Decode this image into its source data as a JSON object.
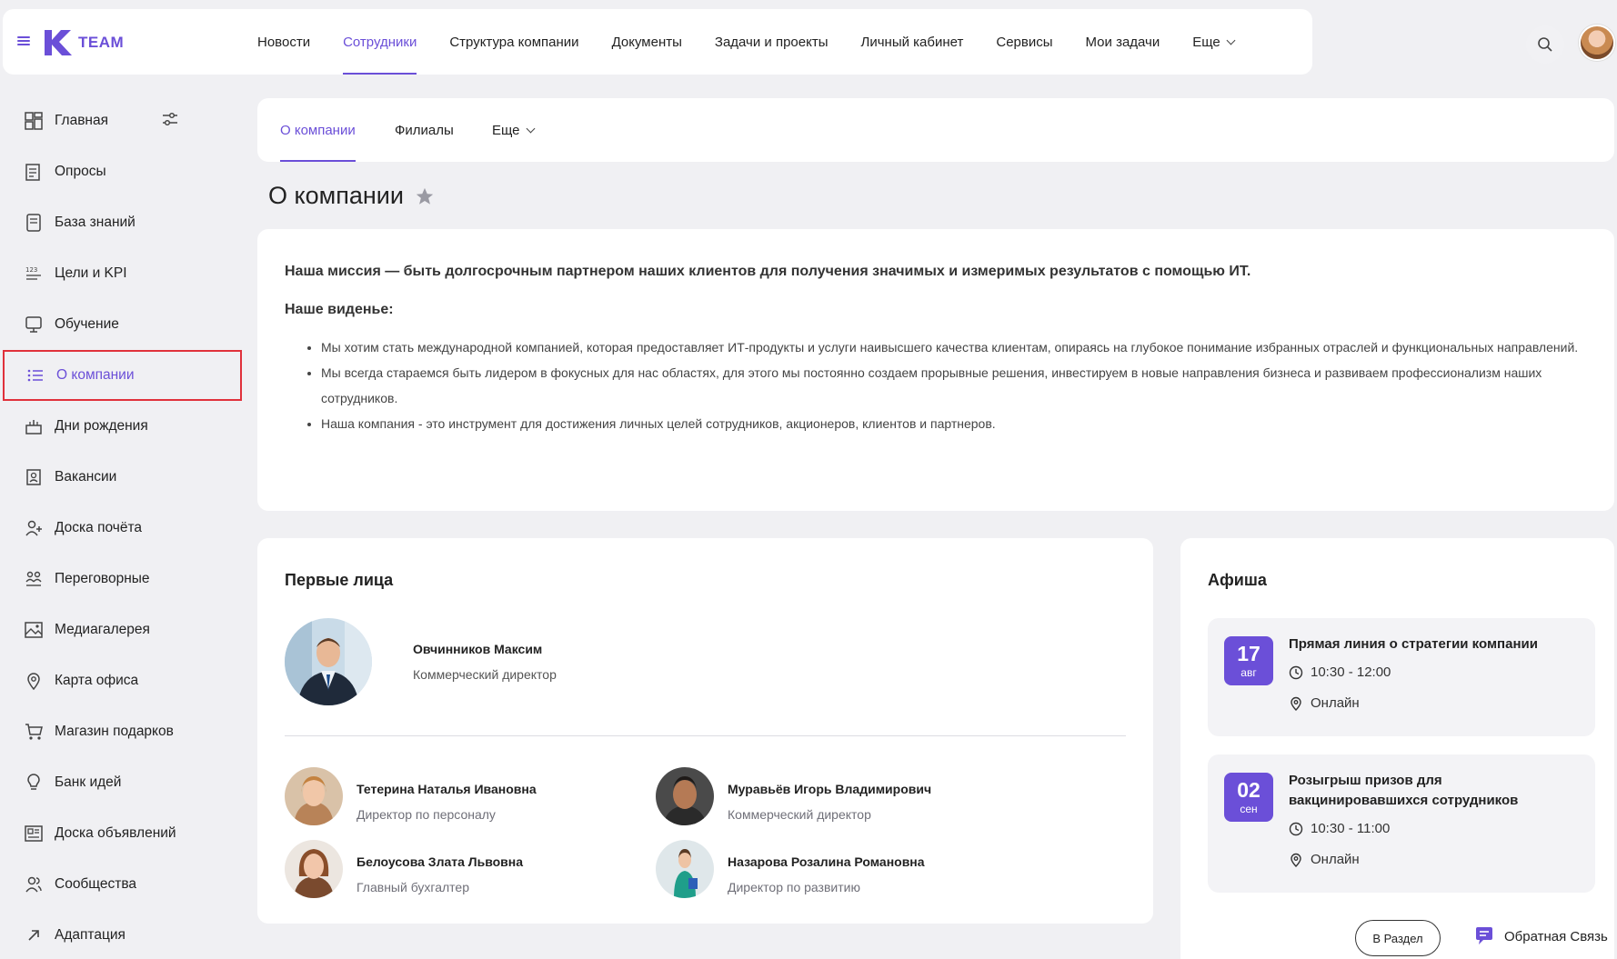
{
  "brand": {
    "name": "TEAM",
    "accent": "#6b4fd8"
  },
  "topnav": {
    "items": [
      "Новости",
      "Сотрудники",
      "Структура компании",
      "Документы",
      "Задачи и проекты",
      "Личный кабинет",
      "Сервисы",
      "Мои задачи",
      "Еще"
    ],
    "active": "Сотрудники"
  },
  "sidebar": {
    "items": [
      {
        "label": "Главная",
        "icon": "dashboard-icon"
      },
      {
        "label": "Опросы",
        "icon": "survey-icon"
      },
      {
        "label": "База знаний",
        "icon": "book-icon"
      },
      {
        "label": "Цели и KPI",
        "icon": "kpi-icon"
      },
      {
        "label": "Обучение",
        "icon": "learning-icon"
      },
      {
        "label": "О компании",
        "icon": "list-icon"
      },
      {
        "label": "Дни рождения",
        "icon": "cake-icon"
      },
      {
        "label": "Вакансии",
        "icon": "vacancy-icon"
      },
      {
        "label": "Доска почёта",
        "icon": "honor-icon"
      },
      {
        "label": "Переговорные",
        "icon": "meeting-icon"
      },
      {
        "label": "Медиагалерея",
        "icon": "gallery-icon"
      },
      {
        "label": "Карта офиса",
        "icon": "map-pin-icon"
      },
      {
        "label": "Магазин подарков",
        "icon": "cart-icon"
      },
      {
        "label": "Банк идей",
        "icon": "lightbulb-icon"
      },
      {
        "label": "Доска объявлений",
        "icon": "board-icon"
      },
      {
        "label": "Сообщества",
        "icon": "community-icon"
      },
      {
        "label": "Адаптация",
        "icon": "arrow-icon"
      }
    ],
    "active": "О компании"
  },
  "subtabs": {
    "items": [
      "О компании",
      "Филиалы",
      "Еще"
    ],
    "active": "О компании"
  },
  "page": {
    "title": "О компании"
  },
  "mission": {
    "statement": "Наша миссия — быть долгосрочным партнером наших клиентов для получения значимых и измеримых результатов с помощью ИТ.",
    "vision_title": "Наше виденье:",
    "vision_items": [
      "Мы хотим стать международной компанией, которая предоставляет ИТ-продукты и услуги наивысшего качества клиентам, опираясь на глубокое понимание избранных отраслей и функциональных направлений.",
      "Мы всегда стараемся быть лидером в фокусных для нас областях, для этого мы постоянно создаем прорывные решения, инвестируем в новые направления бизнеса и развиваем профессионализм наших сотрудников.",
      "Наша компания - это инструмент для достижения личных целей сотрудников, акционеров, клиентов и партнеров."
    ]
  },
  "leaders": {
    "title": "Первые лица",
    "chief": {
      "name": "Овчинников Максим",
      "position": "Коммерческий директор"
    },
    "people": [
      {
        "name": "Тетерина Наталья Ивановна",
        "position": "Директор по персоналу"
      },
      {
        "name": "Муравьёв Игорь Владимирович",
        "position": "Коммерческий директор"
      },
      {
        "name": "Белоусова Злата Львовна",
        "position": "Главный бухгалтер"
      },
      {
        "name": "Назарова Розалина Романовна",
        "position": "Директор по развитию"
      }
    ]
  },
  "events": {
    "title": "Афиша",
    "items": [
      {
        "day": "17",
        "month": "авг",
        "title": "Прямая линия о стратегии компании",
        "time": "10:30 - 12:00",
        "place": "Онлайн"
      },
      {
        "day": "02",
        "month": "сен",
        "title": "Розыгрыш призов для вакцинировавшихся сотрудников",
        "time": "10:30 - 11:00",
        "place": "Онлайн"
      }
    ],
    "section_button": "В Раздел"
  },
  "feedback": {
    "label": "Обратная Связь"
  }
}
